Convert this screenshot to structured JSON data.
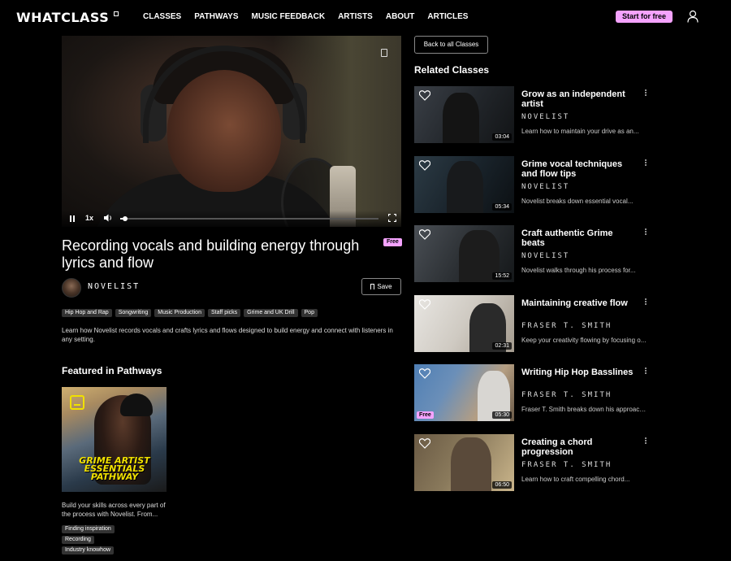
{
  "nav": {
    "logo": "WHATCLASS",
    "links": [
      "CLASSES",
      "PATHWAYS",
      "MUSIC FEEDBACK",
      "ARTISTS",
      "ABOUT",
      "ARTICLES"
    ],
    "cta": "Start for free",
    "accent_color": "#f5a3ff"
  },
  "player": {
    "speed": "1x",
    "progress_fraction": 0.01
  },
  "lesson": {
    "title": "Recording vocals and building energy through lyrics and flow",
    "badge": "Free",
    "artist": "NOVELIST",
    "save_label": "Save",
    "tags": [
      "Hip Hop and Rap",
      "Songwriting",
      "Music Production",
      "Staff picks",
      "Grime and UK Drill",
      "Pop"
    ],
    "description": "Learn how Novelist records vocals and crafts lyrics and flows designed to build energy and connect with listeners in any setting."
  },
  "featured": {
    "heading": "Featured in Pathways",
    "pathway_text": "GRIME ARTIST ESSENTIALS PATHWAY",
    "description": "Build your skills across every part of the process with Novelist. From...",
    "tags": [
      "Finding inspiration",
      "Recording",
      "Industry knowhow"
    ]
  },
  "sidebar": {
    "back_label": "Back to all Classes",
    "heading": "Related Classes",
    "cards": [
      {
        "title": "Grow as an independent artist",
        "artist": "NOVELIST",
        "desc": "Learn how to maintain your drive as an...",
        "duration": "03:04",
        "free": ""
      },
      {
        "title": "Grime vocal techniques and flow tips",
        "artist": "NOVELIST",
        "desc": "Novelist breaks down essential vocal...",
        "duration": "05:34",
        "free": ""
      },
      {
        "title": "Craft authentic Grime beats",
        "artist": "NOVELIST",
        "desc": "Novelist walks through his process for...",
        "duration": "15:52",
        "free": ""
      },
      {
        "title": "Maintaining creative flow",
        "artist": "FRASER T. SMITH",
        "desc": "Keep your creativity flowing by focusing o...",
        "duration": "02:31",
        "free": ""
      },
      {
        "title": "Writing Hip Hop Basslines",
        "artist": "FRASER T. SMITH",
        "desc": "Fraser T. Smith breaks down his approach...",
        "duration": "05:30",
        "free": "Free"
      },
      {
        "title": "Creating a chord progression",
        "artist": "FRASER T. SMITH",
        "desc": "Learn how to craft compelling chord...",
        "duration": "06:50",
        "free": ""
      }
    ]
  }
}
